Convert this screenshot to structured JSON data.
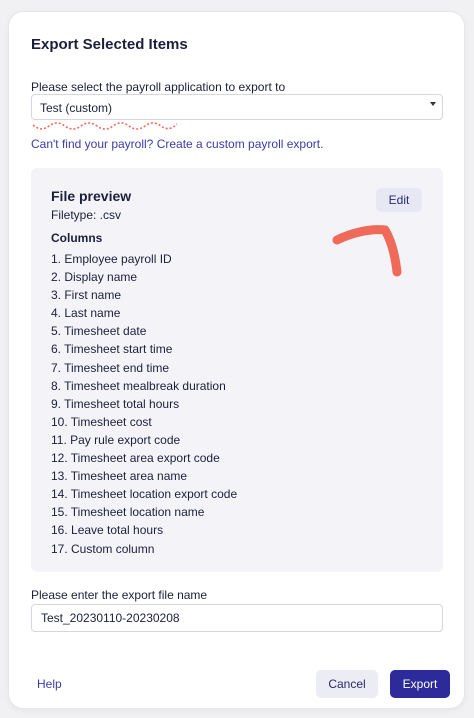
{
  "dialog": {
    "title": "Export Selected Items"
  },
  "payroll_select": {
    "label": "Please select the payroll application to export to",
    "value": "Test (custom)"
  },
  "custom_link": "Can't find your payroll? Create a custom payroll export.",
  "preview": {
    "title": "File preview",
    "filetype": "Filetype: .csv",
    "edit_label": "Edit",
    "columns_title": "Columns",
    "columns": [
      "1. Employee payroll ID",
      "2. Display name",
      "3. First name",
      "4. Last name",
      "5. Timesheet date",
      "6. Timesheet start time",
      "7. Timesheet end time",
      "8. Timesheet mealbreak duration",
      "9. Timesheet total hours",
      "10. Timesheet cost",
      "11. Pay rule export code",
      "12. Timesheet area export code",
      "13. Timesheet area name",
      "14. Timesheet location export code",
      "15. Timesheet location name",
      "16. Leave total hours",
      "17. Custom column"
    ]
  },
  "filename": {
    "label": "Please enter the export file name",
    "value": "Test_20230110-20230208"
  },
  "footer": {
    "help_label": "Help",
    "cancel_label": "Cancel",
    "export_label": "Export"
  },
  "colors": {
    "primary": "#2d2a9a",
    "link": "#3b3ba8",
    "annotation": "#f06a5a"
  }
}
